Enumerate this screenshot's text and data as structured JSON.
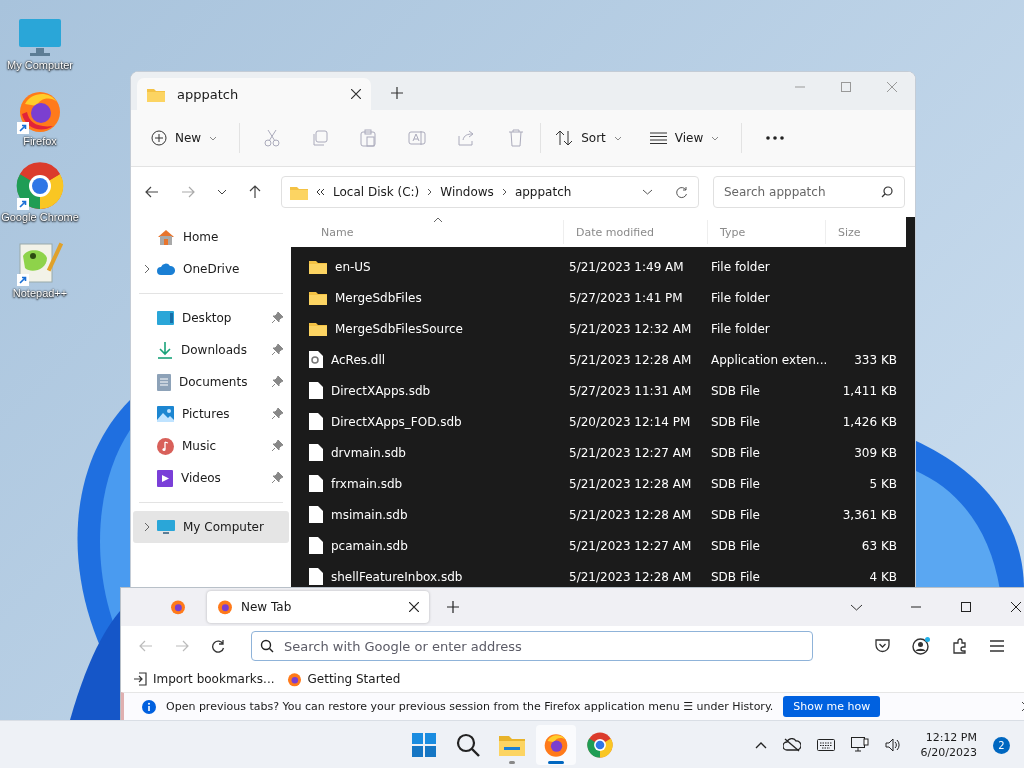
{
  "desktop_icons": [
    {
      "label": "My Computer",
      "kind": "computer",
      "shortcut": false
    },
    {
      "label": "Firefox",
      "kind": "firefox",
      "shortcut": true
    },
    {
      "label": "Google Chrome",
      "kind": "chrome",
      "shortcut": true
    },
    {
      "label": "Notepad++",
      "kind": "notepad",
      "shortcut": true
    }
  ],
  "explorer": {
    "tab_title": "apppatch",
    "toolbar": {
      "new": "New",
      "sort": "Sort",
      "view": "View"
    },
    "path": [
      "Local Disk (C:)",
      "Windows",
      "apppatch"
    ],
    "search": {
      "placeholder": "Search apppatch"
    },
    "sidebar": [
      {
        "items": [
          {
            "label": "Home",
            "kind": "home",
            "expandable": false,
            "pinned": false,
            "selected": false
          },
          {
            "label": "OneDrive",
            "kind": "cloud",
            "expandable": true,
            "pinned": false,
            "selected": false
          }
        ]
      },
      {
        "items": [
          {
            "label": "Desktop",
            "kind": "desktop",
            "expandable": false,
            "pinned": true,
            "selected": false
          },
          {
            "label": "Downloads",
            "kind": "download",
            "expandable": false,
            "pinned": true,
            "selected": false
          },
          {
            "label": "Documents",
            "kind": "document",
            "expandable": false,
            "pinned": true,
            "selected": false
          },
          {
            "label": "Pictures",
            "kind": "pictures",
            "expandable": false,
            "pinned": true,
            "selected": false
          },
          {
            "label": "Music",
            "kind": "music",
            "expandable": false,
            "pinned": true,
            "selected": false
          },
          {
            "label": "Videos",
            "kind": "videos",
            "expandable": false,
            "pinned": true,
            "selected": false
          }
        ]
      },
      {
        "items": [
          {
            "label": "My Computer",
            "kind": "computer",
            "expandable": true,
            "pinned": false,
            "selected": true
          }
        ]
      }
    ],
    "columns": [
      "Name",
      "Date modified",
      "Type",
      "Size"
    ],
    "files": [
      {
        "name": "en-US",
        "kind": "folder",
        "date": "5/21/2023 1:49 AM",
        "type": "File folder"
      },
      {
        "name": "MergeSdbFiles",
        "kind": "folder",
        "date": "5/27/2023 1:41 PM",
        "type": "File folder"
      },
      {
        "name": "MergeSdbFilesSource",
        "kind": "folder",
        "date": "5/21/2023 12:32 AM",
        "type": "File folder"
      },
      {
        "name": "AcRes.dll",
        "kind": "dll",
        "date": "5/21/2023 12:28 AM",
        "type": "Application exten...",
        "size": "333 KB"
      },
      {
        "name": "DirectXApps.sdb",
        "kind": "file",
        "date": "5/27/2023 11:31 AM",
        "type": "SDB File",
        "size": "1,411 KB"
      },
      {
        "name": "DirectXApps_FOD.sdb",
        "kind": "file",
        "date": "5/20/2023 12:14 PM",
        "type": "SDB File",
        "size": "1,426 KB"
      },
      {
        "name": "drvmain.sdb",
        "kind": "file",
        "date": "5/21/2023 12:27 AM",
        "type": "SDB File",
        "size": "309 KB"
      },
      {
        "name": "frxmain.sdb",
        "kind": "file",
        "date": "5/21/2023 12:28 AM",
        "type": "SDB File",
        "size": "5 KB"
      },
      {
        "name": "msimain.sdb",
        "kind": "file",
        "date": "5/21/2023 12:28 AM",
        "type": "SDB File",
        "size": "3,361 KB"
      },
      {
        "name": "pcamain.sdb",
        "kind": "file",
        "date": "5/21/2023 12:27 AM",
        "type": "SDB File",
        "size": "63 KB"
      },
      {
        "name": "shellFeatureInbox.sdb",
        "kind": "file",
        "date": "5/21/2023 12:28 AM",
        "type": "SDB File",
        "size": "4 KB"
      }
    ]
  },
  "firefox": {
    "tabs": [
      {
        "kind": "pinned",
        "selected": false
      },
      {
        "kind": "page",
        "title": "New Tab",
        "selected": true
      }
    ],
    "urlbar": {
      "placeholder": "Search with Google or enter address"
    },
    "bookmarks": [
      {
        "label": "Import bookmarks...",
        "kind": "import"
      },
      {
        "label": "Getting Started",
        "kind": "firefox"
      }
    ],
    "notification": {
      "text": "Open previous tabs? You can restore your previous session from the Firefox application menu ☰ under History.",
      "button": "Show me how"
    }
  },
  "taskbar": {
    "apps": [
      {
        "kind": "start",
        "running": false,
        "active": false
      },
      {
        "kind": "search",
        "running": false,
        "active": false
      },
      {
        "kind": "explorer",
        "running": true,
        "active": false
      },
      {
        "kind": "firefox",
        "running": true,
        "active": true
      },
      {
        "kind": "chrome",
        "running": false,
        "active": false
      }
    ],
    "time": "12:12 PM",
    "date": "6/20/2023",
    "notifications": "2"
  }
}
